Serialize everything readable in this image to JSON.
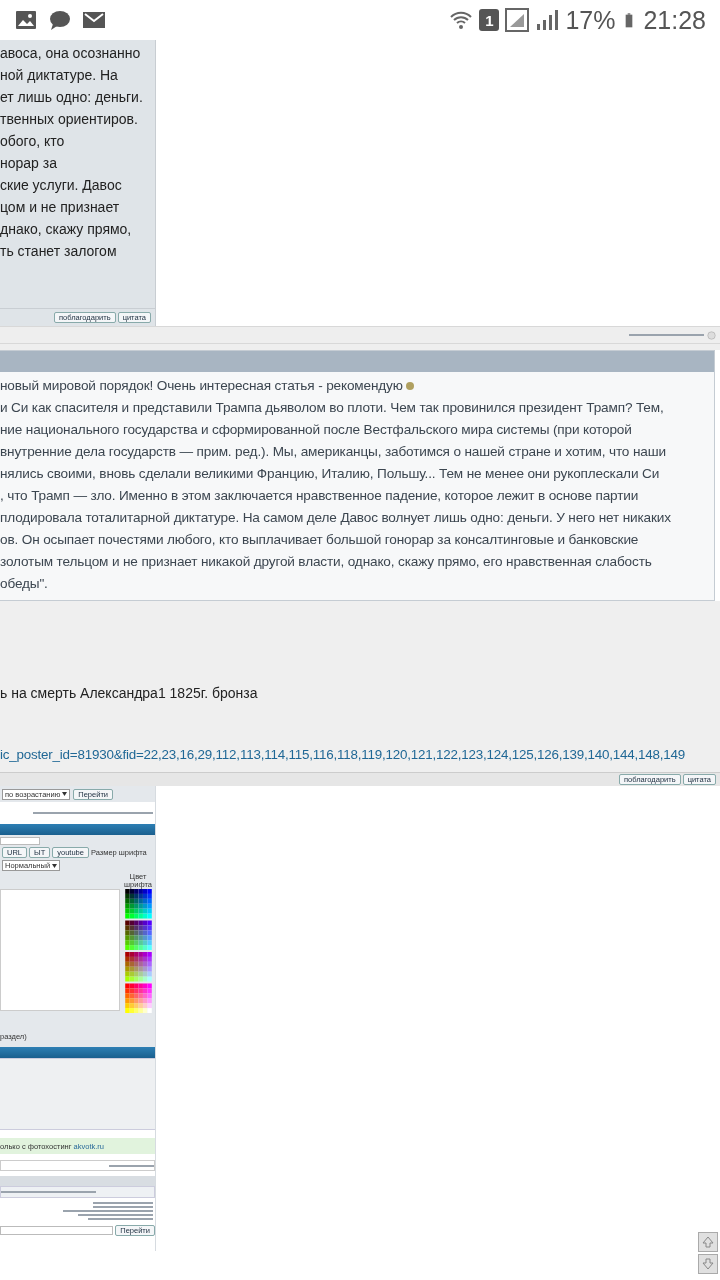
{
  "status_bar": {
    "sim": "1",
    "battery": "17%",
    "time": "21:28"
  },
  "top_post": {
    "lines": [
      "авоса, она осознанно",
      "ной диктатуре. На",
      "ет лишь одно: деньги.",
      "твенных ориентиров.",
      "обого, кто",
      "норар за",
      "ские услуги. Давос",
      "цом и не признает",
      "днако, скажу прямо,",
      "ть станет залогом"
    ],
    "buttons": [
      "поблагодарить",
      "цитата"
    ]
  },
  "quote": {
    "lines": [
      "новый мировой порядок! Очень интересная статья - рекомендую",
      "и Си как спасителя и представили Трампа дьяволом во плоти. Чем так провинился президент Трамп? Тем,",
      "ние национального государства и сформированной после Вестфальского мира системы (при которой",
      "внутренние дела государств — прим. ред.). Мы, американцы, заботимся о нашей стране и хотим, что наши",
      "нялись своими, вновь сделали великими Францию, Италию, Польшу... Тем не менее они рукоплескали Си",
      ", что Трамп — зло. Именно в этом заключается нравственное падение, которое лежит в основе партии",
      "плодировала тоталитарной диктатуре. На самом деле Давос волнует лишь одно: деньги. У него нет никаких",
      "ов. Он осыпает почестями любого, кто выплачивает большой гонорар за консалтинговые и банковские",
      " золотым тельцом и не признает никакой другой власти, однако, скажу прямо, его нравственная слабость",
      "обеды\"."
    ]
  },
  "message": {
    "text": "ь на смерть Александра1 1825г. бронза",
    "link": "ic_poster_id=81930&fid=22,23,16,29,112,113,114,115,116,118,119,120,121,122,123,124,125,126,139,140,144,148,149",
    "buttons": [
      "поблагодарить",
      "цитата"
    ]
  },
  "bottom": {
    "sort_order": "по возрастанию",
    "go": "Перейти",
    "toolbar": [
      "URL",
      "ЫТ",
      "youtube"
    ],
    "font_size_label": "Размер шрифта",
    "font_size": "Нормальный",
    "color_label": "Цвет шрифта",
    "section_note": "раздел)",
    "photo_note": "олько с фотохостинг",
    "photo_link": "akvotk.ru",
    "jump_go": "Перейти"
  }
}
